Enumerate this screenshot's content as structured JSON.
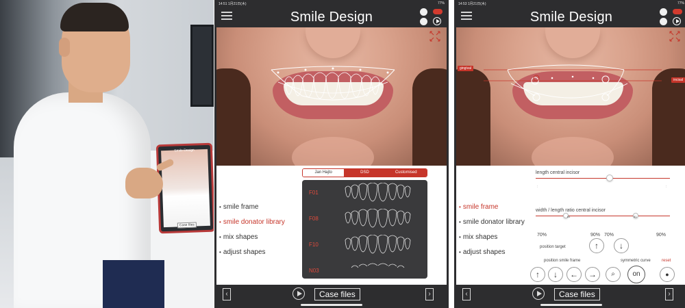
{
  "photo": {
    "tablet_title": "Smile Design",
    "tablet_case": "Case files"
  },
  "devices": [
    {
      "status_left": "14:51  1月21日(木)",
      "status_right": "77%",
      "title": "Smile Design",
      "menu": [
        {
          "label": "smile frame",
          "active": false
        },
        {
          "label": "smile donator library",
          "active": true
        },
        {
          "label": "mix shapes",
          "active": false
        },
        {
          "label": "adjust shapes",
          "active": false
        }
      ],
      "tabs": [
        {
          "label": "Jan Hajto",
          "selected": true
        },
        {
          "label": "DSD",
          "selected": false
        },
        {
          "label": "Customised",
          "selected": false
        }
      ],
      "library": [
        "F01",
        "F08",
        "F10",
        "N03"
      ],
      "case_files": "Case files"
    },
    {
      "status_left": "14:53  1月21日(木)",
      "status_right": "77%",
      "title": "Smile Design",
      "tag_left": "gingival",
      "tag_right": "incisal",
      "menu": [
        {
          "label": "smile frame",
          "active": true
        },
        {
          "label": "smile donator library",
          "active": false
        },
        {
          "label": "mix shapes",
          "active": false
        },
        {
          "label": "adjust shapes",
          "active": false
        }
      ],
      "slider1_label": "length central incisor",
      "slider1_value": 0.55,
      "slider2_label": "width / length ratio central incisor",
      "slider2_value_a": 0.23,
      "slider2_value_b": 0.75,
      "slider2_knob_a": "81",
      "slider2_knob_b": "81",
      "pct": [
        "70%",
        "90%",
        "70%",
        "90%"
      ],
      "position_target": "position target",
      "position_smile_frame": "position smile frame",
      "symmetric_curve": "symmetric curve",
      "reset": "reset",
      "on_label": "on",
      "case_files": "Case files"
    }
  ],
  "colors": {
    "accent": "#c6352a",
    "dark_bar": "#2d2d2f",
    "library_bg": "#3a3a3c"
  }
}
